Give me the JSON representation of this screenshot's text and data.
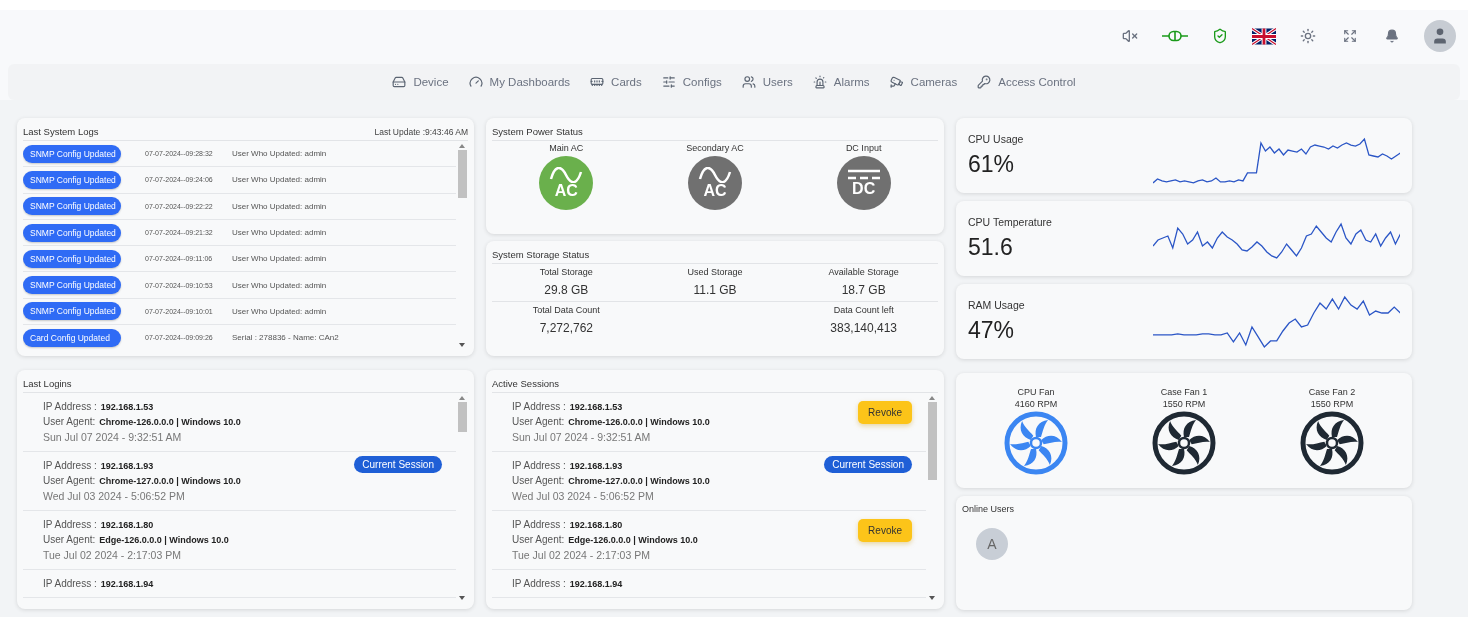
{
  "topbar": {
    "icons": [
      {
        "kind": "mute"
      },
      {
        "kind": "plug",
        "on": true
      },
      {
        "kind": "shield",
        "on": true
      },
      {
        "kind": "flag"
      },
      {
        "kind": "sun"
      },
      {
        "kind": "fullscreen"
      },
      {
        "kind": "bell"
      },
      {
        "kind": "avatar"
      }
    ]
  },
  "nav": [
    {
      "kind": "device",
      "label": "Device"
    },
    {
      "kind": "dashboards",
      "label": "My Dashboards"
    },
    {
      "kind": "cards",
      "label": "Cards"
    },
    {
      "kind": "configs",
      "label": "Configs"
    },
    {
      "kind": "users",
      "label": "Users"
    },
    {
      "kind": "alarms",
      "label": "Alarms"
    },
    {
      "kind": "cameras",
      "label": "Cameras"
    },
    {
      "kind": "access",
      "label": "Access Control"
    }
  ],
  "system_logs": {
    "title": "Last System Logs",
    "last_update": "Last Update :9:43:46 AM",
    "rows": [
      {
        "badge": "SNMP Config Updated",
        "time": "07-07-2024--09:28:32",
        "detail": "User Who Updated: admin"
      },
      {
        "badge": "SNMP Config Updated",
        "time": "07-07-2024--09:24:06",
        "detail": "User Who Updated: admin"
      },
      {
        "badge": "SNMP Config Updated",
        "time": "07-07-2024--09:22:22",
        "detail": "User Who Updated: admin"
      },
      {
        "badge": "SNMP Config Updated",
        "time": "07-07-2024--09:21:32",
        "detail": "User Who Updated: admin"
      },
      {
        "badge": "SNMP Config Updated",
        "time": "07-07-2024--09:11:06",
        "detail": "User Who Updated: admin"
      },
      {
        "badge": "SNMP Config Updated",
        "time": "07-07-2024--09:10:53",
        "detail": "User Who Updated: admin"
      },
      {
        "badge": "SNMP Config Updated",
        "time": "07-07-2024--09:10:01",
        "detail": "User Who Updated: admin"
      },
      {
        "badge": "Card Config Updated",
        "time": "07-07-2024--09:09:26",
        "detail": "Serial : 278836 - Name: CAn2"
      }
    ]
  },
  "power": {
    "title": "System Power Status",
    "sources": [
      {
        "label": "Main AC",
        "kind": "ac",
        "type": "AC",
        "on": true
      },
      {
        "label": "Secondary AC",
        "kind": "ac",
        "type": "AC",
        "on": false
      },
      {
        "label": "DC Input",
        "kind": "dc",
        "type": "DC",
        "on": false
      }
    ]
  },
  "storage": {
    "title": "System Storage Status",
    "rows": [
      [
        {
          "label": "Total Storage",
          "value": "29.8 GB"
        },
        {
          "label": "Used Storage",
          "value": "11.1 GB"
        },
        {
          "label": "Available Storage",
          "value": "18.7 GB"
        }
      ],
      [
        {
          "label": "Total Data Count",
          "value": "7,272,762"
        },
        null,
        {
          "label": "Data Count left",
          "value": "383,140,413"
        }
      ]
    ]
  },
  "metrics": [
    {
      "label": "CPU Usage",
      "value": "61%"
    },
    {
      "label": "CPU Temperature",
      "value": "51.6"
    },
    {
      "label": "RAM Usage",
      "value": "47%"
    }
  ],
  "last_logins": {
    "title": "Last Logins",
    "rows": [
      {
        "ip_label": "IP Address :",
        "ip": "192.168.1.53",
        "agent_label": "User Agent:",
        "agent": "Chrome-126.0.0.0 | Windows 10.0",
        "date": "Sun Jul 07 2024 - 9:32:51 AM"
      },
      {
        "ip_label": "IP Address :",
        "ip": "192.168.1.93",
        "agent_label": "User Agent:",
        "agent": "Chrome-127.0.0.0 | Windows 10.0",
        "date": "Wed Jul 03 2024 - 5:06:52 PM",
        "action": {
          "kind": "current",
          "label": "Current Session"
        }
      },
      {
        "ip_label": "IP Address :",
        "ip": "192.168.1.80",
        "agent_label": "User Agent:",
        "agent": "Edge-126.0.0.0 | Windows 10.0",
        "date": "Tue Jul 02 2024 - 2:17:03 PM"
      },
      {
        "ip_label": "IP Address :",
        "ip": "192.168.1.94"
      }
    ]
  },
  "active_sessions": {
    "title": "Active Sessions",
    "rows": [
      {
        "ip_label": "IP Address :",
        "ip": "192.168.1.53",
        "agent_label": "User Agent:",
        "agent": "Chrome-126.0.0.0 | Windows 10.0",
        "date": "Sun Jul 07 2024 - 9:32:51 AM",
        "action": {
          "kind": "revoke",
          "label": "Revoke"
        }
      },
      {
        "ip_label": "IP Address :",
        "ip": "192.168.1.93",
        "agent_label": "User Agent:",
        "agent": "Chrome-127.0.0.0 | Windows 10.0",
        "date": "Wed Jul 03 2024 - 5:06:52 PM",
        "action": {
          "kind": "current",
          "label": "Current Session"
        }
      },
      {
        "ip_label": "IP Address :",
        "ip": "192.168.1.80",
        "agent_label": "User Agent:",
        "agent": "Edge-126.0.0.0 | Windows 10.0",
        "date": "Tue Jul 02 2024 - 2:17:03 PM",
        "action": {
          "kind": "revoke",
          "label": "Revoke"
        }
      },
      {
        "ip_label": "IP Address :",
        "ip": "192.168.1.94"
      }
    ]
  },
  "fans": [
    {
      "label": "CPU Fan",
      "rpm": "4160 RPM",
      "active": true
    },
    {
      "label": "Case Fan 1",
      "rpm": "1550 RPM",
      "active": false
    },
    {
      "label": "Case Fan 2",
      "rpm": "1550 RPM",
      "active": false
    }
  ],
  "online_users": {
    "title": "Online Users",
    "users": [
      {
        "initial": "A"
      }
    ]
  }
}
